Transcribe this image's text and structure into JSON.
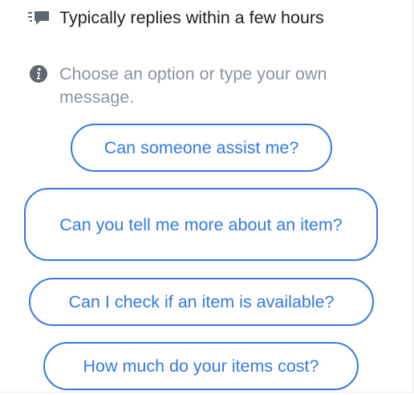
{
  "page": {
    "response_time": "Typically replies within a few hours",
    "hint": "Choose an option or type your own message."
  },
  "icons": {
    "response_time": "speech-bubble-lines-icon",
    "hint": "info-icon"
  },
  "colors": {
    "accent": "#3578e5",
    "text_primary": "#1c1e21",
    "text_secondary": "#8d949e",
    "icon": "#606770"
  },
  "options": [
    "Can someone assist me?",
    "Can you tell me more about an item?",
    "Can I check if an item is available?",
    "How much do your items cost?"
  ]
}
